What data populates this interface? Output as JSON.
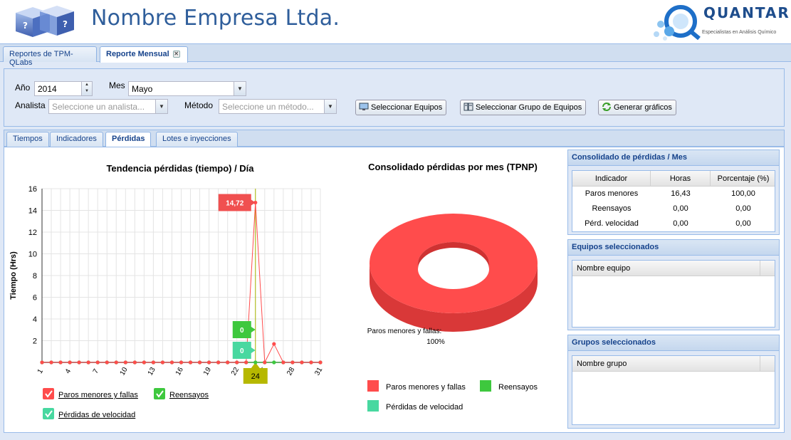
{
  "header": {
    "company_title": "Nombre Empresa Ltda.",
    "brand_name": "QUANTAR",
    "brand_tagline": "Especialistas en Análisis Químico"
  },
  "main_tabs": [
    {
      "label": "Reportes de TPM-QLabs",
      "active": false
    },
    {
      "label": "Reporte Mensual",
      "active": true
    }
  ],
  "filters": {
    "year_label": "Año",
    "year_value": "2014",
    "month_label": "Mes",
    "month_value": "Mayo",
    "analyst_label": "Analista",
    "analyst_placeholder": "Seleccione un analista...",
    "method_label": "Método",
    "method_placeholder": "Seleccione un método...",
    "btn_select_equipment": "Seleccionar Equipos",
    "btn_select_group": "Seleccionar Grupo de Equipos",
    "btn_generate": "Generar gráficos"
  },
  "sub_tabs": [
    {
      "label": "Tiempos",
      "active": false
    },
    {
      "label": "Indicadores",
      "active": false
    },
    {
      "label": "Pérdidas",
      "active": true
    },
    {
      "label": "Lotes e inyecciones",
      "active": false
    }
  ],
  "chart_data": [
    {
      "type": "line",
      "title": "Tendencia pérdidas (tiempo) / Día",
      "ylabel": "Tiempo (Hrs)",
      "xlabel": "",
      "ylim": [
        0,
        16
      ],
      "y_ticks": [
        2,
        4,
        6,
        8,
        10,
        12,
        14,
        16
      ],
      "x_ticks": [
        1,
        4,
        7,
        10,
        13,
        16,
        19,
        22,
        25,
        28,
        31
      ],
      "grid": true,
      "x": [
        1,
        2,
        3,
        4,
        5,
        6,
        7,
        8,
        9,
        10,
        11,
        12,
        13,
        14,
        15,
        16,
        17,
        18,
        19,
        20,
        21,
        22,
        23,
        24,
        25,
        26,
        27,
        28,
        29,
        30,
        31
      ],
      "series": [
        {
          "name": "Paros menores y fallas",
          "color": "#ff4c4c",
          "values": [
            0,
            0,
            0,
            0,
            0,
            0,
            0,
            0,
            0,
            0,
            0,
            0,
            0,
            0,
            0,
            0,
            0,
            0,
            0,
            0,
            0,
            0,
            0,
            14.72,
            0,
            1.7,
            0,
            0,
            0,
            0,
            0
          ]
        },
        {
          "name": "Reensayos",
          "color": "#3ec83e",
          "values": [
            0,
            0,
            0,
            0,
            0,
            0,
            0,
            0,
            0,
            0,
            0,
            0,
            0,
            0,
            0,
            0,
            0,
            0,
            0,
            0,
            0,
            0,
            0,
            0,
            0,
            0,
            0,
            0,
            0,
            0,
            0
          ]
        },
        {
          "name": "Pérdidas de velocidad",
          "color": "#48d8a0",
          "values": [
            0,
            0,
            0,
            0,
            0,
            0,
            0,
            0,
            0,
            0,
            0,
            0,
            0,
            0,
            0,
            0,
            0,
            0,
            0,
            0,
            0,
            0,
            0,
            0,
            0,
            0,
            0,
            0,
            0,
            0,
            0
          ]
        }
      ],
      "tooltip_labels": [
        {
          "text": "14,72",
          "color": "#f05050"
        },
        {
          "text": "0",
          "color": "#3ec83e"
        },
        {
          "text": "0",
          "color": "#48d8a0"
        }
      ],
      "crosshair_label": "24",
      "legend": "bottom"
    },
    {
      "type": "pie",
      "title": "Consolidado pérdidas por mes (TPNP)",
      "slices": [
        {
          "name": "Paros menores y fallas",
          "value": 100,
          "color": "#ff4c4c"
        },
        {
          "name": "Reensayos",
          "value": 0,
          "color": "#3ec83e"
        },
        {
          "name": "Pérdidas de velocidad",
          "value": 0,
          "color": "#48d8a0"
        }
      ],
      "slice_label": "Paros menores y fallas:",
      "slice_pct": "100%",
      "legend": "bottom"
    }
  ],
  "panels": {
    "consolidado": {
      "title": "Consolidado de pérdidas / Mes",
      "columns": [
        "Indicador",
        "Horas",
        "Porcentaje (%)"
      ],
      "rows": [
        [
          "Paros menores",
          "16,43",
          "100,00"
        ],
        [
          "Reensayos",
          "0,00",
          "0,00"
        ],
        [
          "Pérd. velocidad",
          "0,00",
          "0,00"
        ]
      ]
    },
    "equipos": {
      "title": "Equipos seleccionados",
      "column": "Nombre equipo"
    },
    "grupos": {
      "title": "Grupos seleccionados",
      "column": "Nombre grupo"
    }
  }
}
